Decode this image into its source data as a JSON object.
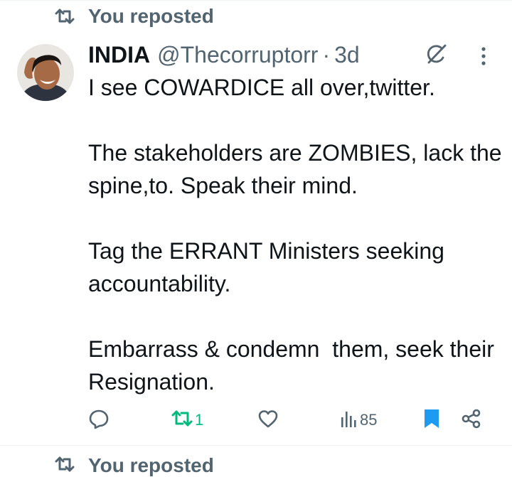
{
  "social_context": {
    "text": "You reposted",
    "icon": "repost-icon"
  },
  "post": {
    "display_name": "INDIA",
    "handle": "@Thecorruptorr",
    "separator": "·",
    "time": "3d",
    "paragraphs": [
      "I see COWARDICE all over,twitter.",
      "The stakeholders are ZOMBIES, lack the spine,to. Speak their mind.",
      "Tag the ERRANT Ministers seeking accountability.",
      "Embarrass & condemn  them, seek their Resignation."
    ],
    "actions": {
      "reposts": "1",
      "views": "85"
    }
  },
  "next_item": {
    "text": "You reposted"
  },
  "colors": {
    "text_primary": "#0f1419",
    "text_secondary": "#536471",
    "repost_active": "#00ba7c",
    "bookmark_active": "#1d9bf0"
  }
}
